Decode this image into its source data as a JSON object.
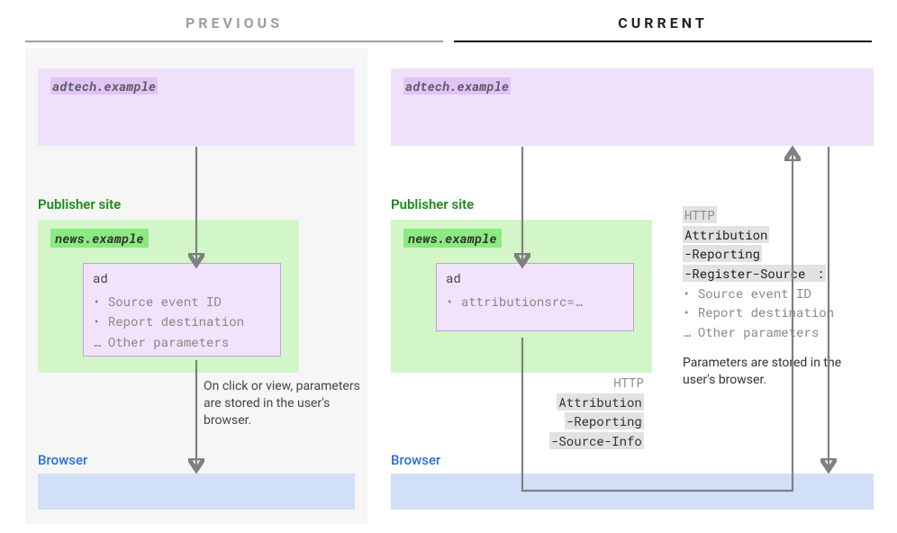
{
  "headers": {
    "previous": "PREVIOUS",
    "current": "CURRENT"
  },
  "adtech": {
    "label": "adtech.example"
  },
  "publisher": {
    "title": "Publisher site",
    "news": "news.example",
    "ad_label": "ad"
  },
  "prev_ad": {
    "l1": "Source event ID",
    "l2": "Report destination",
    "l3": "Other parameters"
  },
  "curr_ad": {
    "l1": "attributionsrc=…"
  },
  "prev_note": "On click or view, parameters are stored in the user's browser.",
  "browser": {
    "label": "Browser"
  },
  "mid_http": {
    "hdr": "HTTP",
    "l1": "Attribution",
    "l2": "-Reporting",
    "l3": "-Source-Info"
  },
  "right": {
    "hdr": "HTTP",
    "h1": "Attribution",
    "h2": "-Reporting",
    "h3": "-Register-Source",
    "colon": " :",
    "s1": "Source event ID",
    "s2": "Report destination",
    "s3": "Other parameters",
    "note": "Parameters are stored in the user's browser."
  }
}
